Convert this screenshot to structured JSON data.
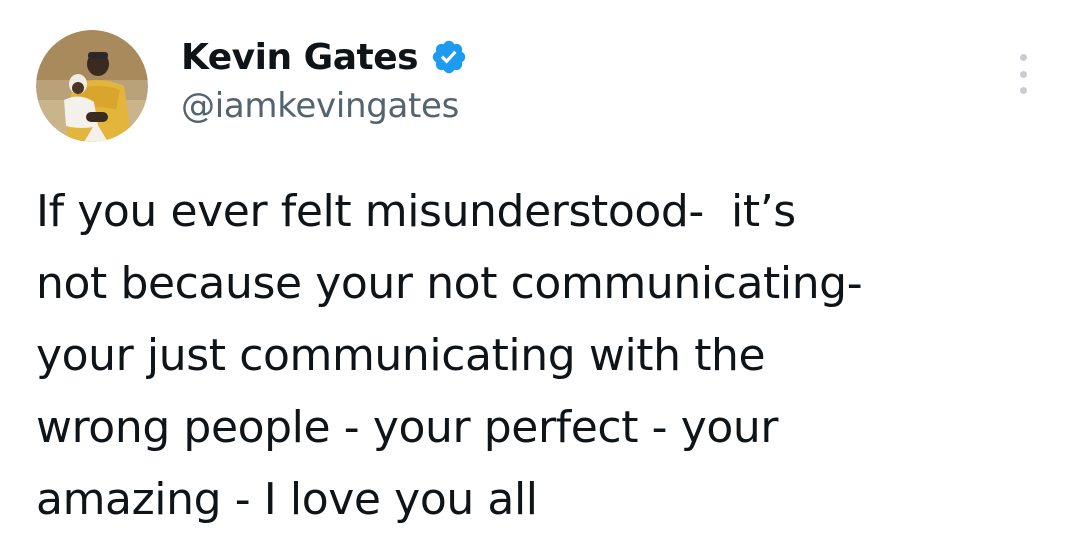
{
  "author": {
    "display_name": "Kevin Gates",
    "handle": "@iamkevingates",
    "verified": true,
    "verified_badge_color": "#1d9bf0"
  },
  "tweet": {
    "lines": [
      "If you ever felt misunderstood-  it’s",
      "not because your not communicating-",
      "your just communicating with the",
      "wrong people - your perfect - your",
      "amazing - I love you all"
    ]
  },
  "icons": {
    "avatar": "profile-photo",
    "verified": "verified-badge-icon",
    "more": "more-options-icon"
  },
  "colors": {
    "text": "#0f1419",
    "secondary_text": "#536471",
    "more_dots": "#c7ced3",
    "background": "#ffffff"
  }
}
